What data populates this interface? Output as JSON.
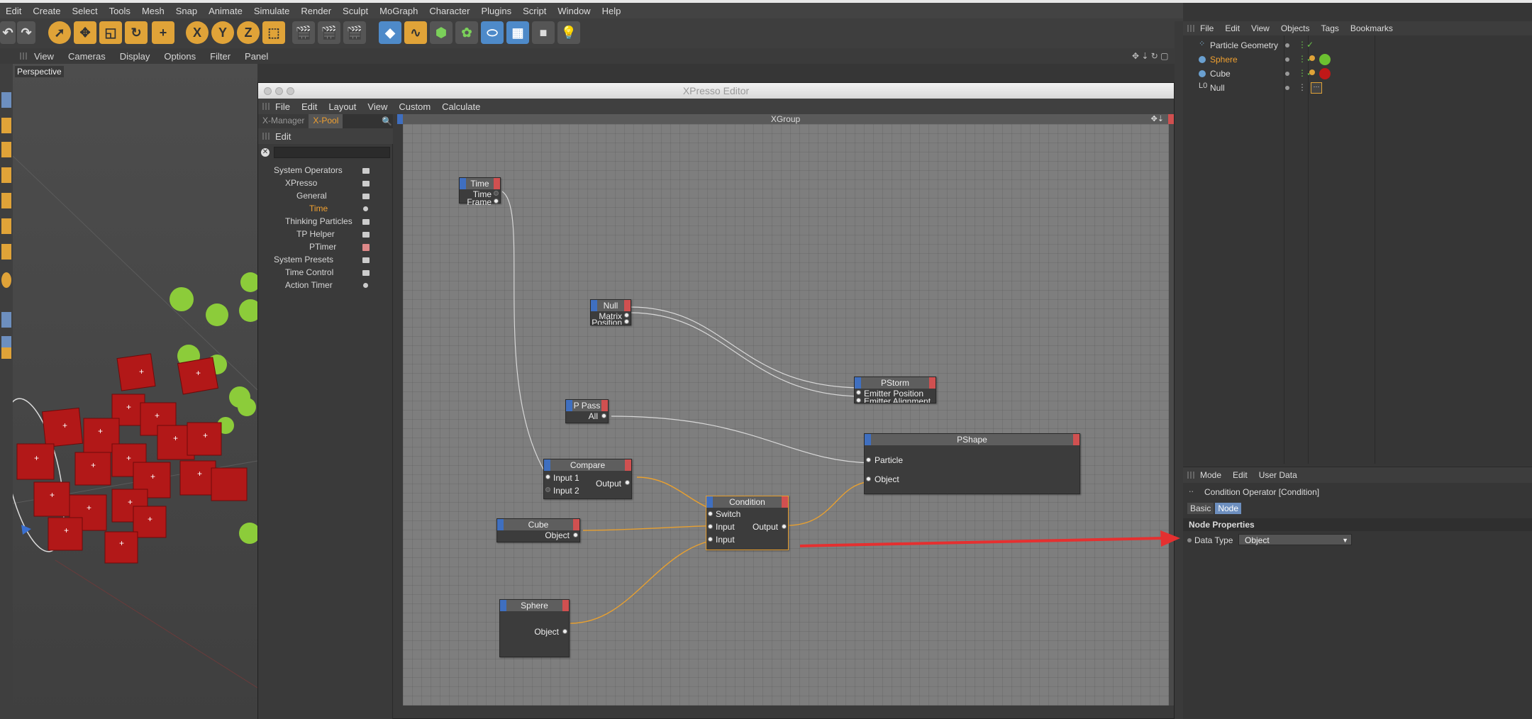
{
  "app": {
    "menu": [
      "Edit",
      "Create",
      "Select",
      "Tools",
      "Mesh",
      "Snap",
      "Animate",
      "Simulate",
      "Render",
      "Sculpt",
      "MoGraph",
      "Character",
      "Plugins",
      "Script",
      "Window",
      "Help"
    ]
  },
  "viewport": {
    "menu": [
      "View",
      "Cameras",
      "Display",
      "Options",
      "Filter",
      "Panel"
    ],
    "label": "Perspective"
  },
  "xpresso": {
    "title": "XPresso Editor",
    "menu": [
      "File",
      "Edit",
      "Layout",
      "View",
      "Custom",
      "Calculate"
    ],
    "tabs": {
      "manager": "X-Manager",
      "pool": "X-Pool"
    },
    "pool_edit": "Edit",
    "tree": [
      {
        "label": "System Operators"
      },
      {
        "label": "XPresso"
      },
      {
        "label": "General"
      },
      {
        "label": "Time"
      },
      {
        "label": "Thinking Particles"
      },
      {
        "label": "TP Helper"
      },
      {
        "label": "PTimer"
      },
      {
        "label": "System Presets"
      },
      {
        "label": "Time Control"
      },
      {
        "label": "Action Timer"
      }
    ],
    "group_title": "XGroup",
    "nodes": {
      "time": {
        "title": "Time",
        "ports": [
          "Time",
          "Frame"
        ]
      },
      "null": {
        "title": "Null",
        "ports": [
          "Matrix",
          "Position"
        ]
      },
      "pstorm": {
        "title": "PStorm",
        "ports": [
          "Emitter Position",
          "Emitter Alignment"
        ]
      },
      "ppass": {
        "title": "P Pass",
        "ports": [
          "All"
        ]
      },
      "pshape": {
        "title": "PShape",
        "ports": [
          "Particle",
          "Object"
        ]
      },
      "compare": {
        "title": "Compare",
        "inputs": [
          "Input 1",
          "Input 2"
        ],
        "output": "Output"
      },
      "condition": {
        "title": "Condition",
        "inputs": [
          "Switch",
          "Input",
          "Input"
        ],
        "output": "Output"
      },
      "cube": {
        "title": "Cube",
        "ports": [
          "Object"
        ]
      },
      "sphere": {
        "title": "Sphere",
        "ports": [
          "Object"
        ]
      }
    }
  },
  "object_manager": {
    "menu": [
      "File",
      "Edit",
      "View",
      "Objects",
      "Tags",
      "Bookmarks"
    ],
    "objects": [
      {
        "name": "Particle Geometry",
        "selected": false
      },
      {
        "name": "Sphere",
        "selected": true
      },
      {
        "name": "Cube",
        "selected": false
      },
      {
        "name": "Null",
        "selected": false
      }
    ]
  },
  "attribute_manager": {
    "menu": [
      "Mode",
      "Edit",
      "User Data"
    ],
    "title": "Condition Operator [Condition]",
    "tabs": [
      "Basic",
      "Node"
    ],
    "section": "Node Properties",
    "data_type_label": "Data Type",
    "data_type_value": "Object"
  },
  "colors": {
    "accent_orange": "#f0a030",
    "port_blue": "#3f6fc0",
    "port_red": "#d05050",
    "wire_orange": "#e8a030",
    "annotation_red": "#e53030"
  }
}
